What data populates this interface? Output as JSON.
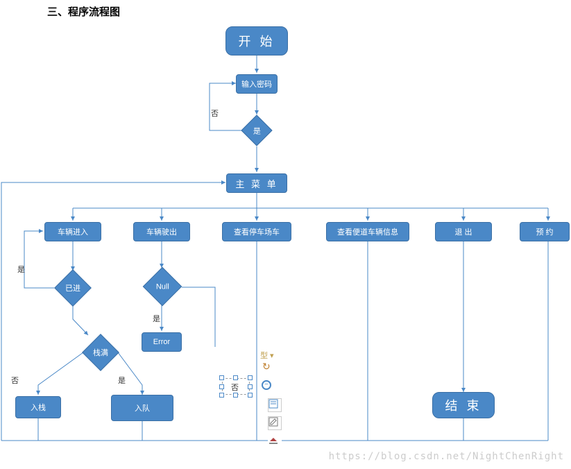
{
  "title": "三、程序流程图",
  "watermark": "https://blog.csdn.net/NightChenRight",
  "nodes": {
    "start": "开 始",
    "input_pw": "输入密码",
    "dec_pw": "是",
    "main_menu": "主 菜 单",
    "car_in": "车辆进入",
    "car_out": "车辆驶出",
    "view_lot": "查看停车场车",
    "view_lane": "查看便道车辆信息",
    "exit": "退   出",
    "reserve": "预   约",
    "dec_in": "已进",
    "dec_null": "Null",
    "dec_full": "栈满",
    "error": "Error",
    "push": "入栈",
    "enqueue": "入队",
    "end": "结 束",
    "sel_text": "否"
  },
  "labels": {
    "no1": "否",
    "yes1": "是",
    "no2": "否",
    "yes2": "是",
    "yes3": "是"
  },
  "chart_data": {
    "type": "diagram",
    "nodes": [
      {
        "id": "start",
        "kind": "terminal",
        "label": "开 始"
      },
      {
        "id": "input_pw",
        "kind": "process",
        "label": "输入密码"
      },
      {
        "id": "dec_pw",
        "kind": "decision",
        "label": "是"
      },
      {
        "id": "main_menu",
        "kind": "process",
        "label": "主 菜 单"
      },
      {
        "id": "car_in",
        "kind": "process",
        "label": "车辆进入"
      },
      {
        "id": "car_out",
        "kind": "process",
        "label": "车辆驶出"
      },
      {
        "id": "view_lot",
        "kind": "process",
        "label": "查看停车场车"
      },
      {
        "id": "view_lane",
        "kind": "process",
        "label": "查看便道车辆信息"
      },
      {
        "id": "exit",
        "kind": "process",
        "label": "退 出"
      },
      {
        "id": "reserve",
        "kind": "process",
        "label": "预 约"
      },
      {
        "id": "dec_in",
        "kind": "decision",
        "label": "已进"
      },
      {
        "id": "dec_null",
        "kind": "decision",
        "label": "Null"
      },
      {
        "id": "dec_full",
        "kind": "decision",
        "label": "栈满"
      },
      {
        "id": "error",
        "kind": "process",
        "label": "Error"
      },
      {
        "id": "push",
        "kind": "process",
        "label": "入栈"
      },
      {
        "id": "enqueue",
        "kind": "process",
        "label": "入队"
      },
      {
        "id": "end",
        "kind": "terminal",
        "label": "结 束"
      }
    ],
    "edges": [
      {
        "from": "start",
        "to": "input_pw"
      },
      {
        "from": "input_pw",
        "to": "dec_pw"
      },
      {
        "from": "dec_pw",
        "to": "main_menu",
        "label": "是"
      },
      {
        "from": "dec_pw",
        "to": "input_pw",
        "label": "否"
      },
      {
        "from": "main_menu",
        "to": "car_in"
      },
      {
        "from": "main_menu",
        "to": "car_out"
      },
      {
        "from": "main_menu",
        "to": "view_lot"
      },
      {
        "from": "main_menu",
        "to": "view_lane"
      },
      {
        "from": "main_menu",
        "to": "exit"
      },
      {
        "from": "main_menu",
        "to": "reserve"
      },
      {
        "from": "car_in",
        "to": "dec_in"
      },
      {
        "from": "dec_in",
        "to": "car_in",
        "label": "是"
      },
      {
        "from": "dec_in",
        "to": "dec_full"
      },
      {
        "from": "dec_full",
        "to": "push",
        "label": "否"
      },
      {
        "from": "dec_full",
        "to": "enqueue",
        "label": "是"
      },
      {
        "from": "car_out",
        "to": "dec_null"
      },
      {
        "from": "dec_null",
        "to": "error",
        "label": "是"
      },
      {
        "from": "exit",
        "to": "end"
      },
      {
        "from": "view_lot",
        "to": "main_menu"
      },
      {
        "from": "view_lane",
        "to": "main_menu"
      },
      {
        "from": "reserve",
        "to": "main_menu"
      },
      {
        "from": "push",
        "to": "main_menu"
      },
      {
        "from": "enqueue",
        "to": "main_menu"
      }
    ]
  }
}
